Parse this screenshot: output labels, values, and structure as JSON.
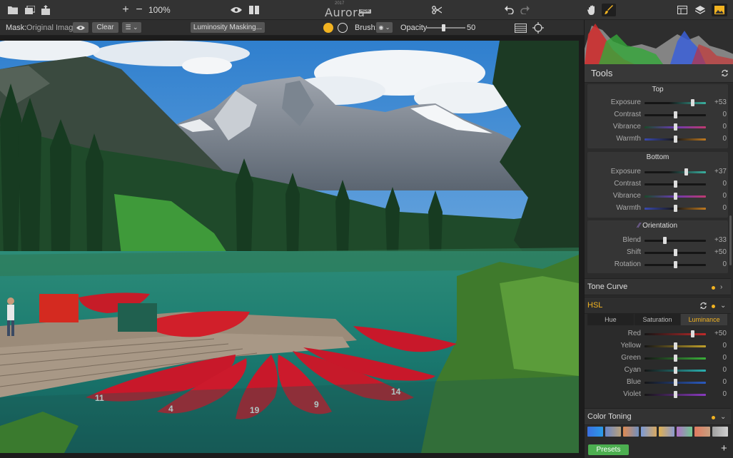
{
  "app": {
    "year": "2017",
    "name": "Aurora",
    "badge": "HDR",
    "zoom": "100%"
  },
  "toolbar": {
    "icons": [
      "folder-icon",
      "stack-icon",
      "export-icon",
      "zoom-in-icon",
      "zoom-out-icon",
      "eye-icon",
      "split-view-icon",
      "scissors-icon",
      "undo-icon",
      "redo-icon",
      "hand-icon",
      "brush-icon",
      "layout-icon",
      "layers-icon",
      "image-icon"
    ]
  },
  "optbar": {
    "mask_label": "Mask:",
    "mask_value": "Original Image",
    "clear_label": "Clear",
    "luminosity_label": "Luminosity Masking...",
    "brush_label": "Brush:",
    "opacity_label": "Opacity",
    "opacity_value": "50"
  },
  "panel": {
    "tools_title": "Tools",
    "top_group": {
      "title": "Top",
      "rows": [
        {
          "name": "Exposure",
          "value": "+53",
          "level": 0.78
        },
        {
          "name": "Contrast",
          "value": "0",
          "level": 0.5
        },
        {
          "name": "Vibrance",
          "value": "0",
          "level": 0.5
        },
        {
          "name": "Warmth",
          "value": "0",
          "level": 0.5
        }
      ]
    },
    "bottom_group": {
      "title": "Bottom",
      "rows": [
        {
          "name": "Exposure",
          "value": "+37",
          "level": 0.68
        },
        {
          "name": "Contrast",
          "value": "0",
          "level": 0.5
        },
        {
          "name": "Vibrance",
          "value": "0",
          "level": 0.5
        },
        {
          "name": "Warmth",
          "value": "0",
          "level": 0.5
        }
      ]
    },
    "orientation_group": {
      "title": "Orientation",
      "rows": [
        {
          "name": "Blend",
          "value": "+33",
          "level": 0.33
        },
        {
          "name": "Shift",
          "value": "+50",
          "level": 0.5
        },
        {
          "name": "Rotation",
          "value": "0",
          "level": 0.5
        }
      ]
    },
    "tone_curve": "Tone Curve",
    "hsl": {
      "title": "HSL",
      "tabs": [
        "Hue",
        "Saturation",
        "Luminance"
      ],
      "active_tab": "Luminance",
      "rows": [
        {
          "name": "Red",
          "value": "+50",
          "level": 0.78
        },
        {
          "name": "Yellow",
          "value": "0",
          "level": 0.5
        },
        {
          "name": "Green",
          "value": "0",
          "level": 0.5
        },
        {
          "name": "Cyan",
          "value": "0",
          "level": 0.5
        },
        {
          "name": "Blue",
          "value": "0",
          "level": 0.5
        },
        {
          "name": "Violet",
          "value": "0",
          "level": 0.5
        }
      ]
    },
    "color_toning": "Color Toning",
    "presets_label": "Presets"
  },
  "photo": {
    "canoe_numbers": [
      "11",
      "4",
      "19",
      "9",
      "14"
    ]
  },
  "colors": {
    "accent": "#f2b321",
    "presets": "#4caf50"
  }
}
